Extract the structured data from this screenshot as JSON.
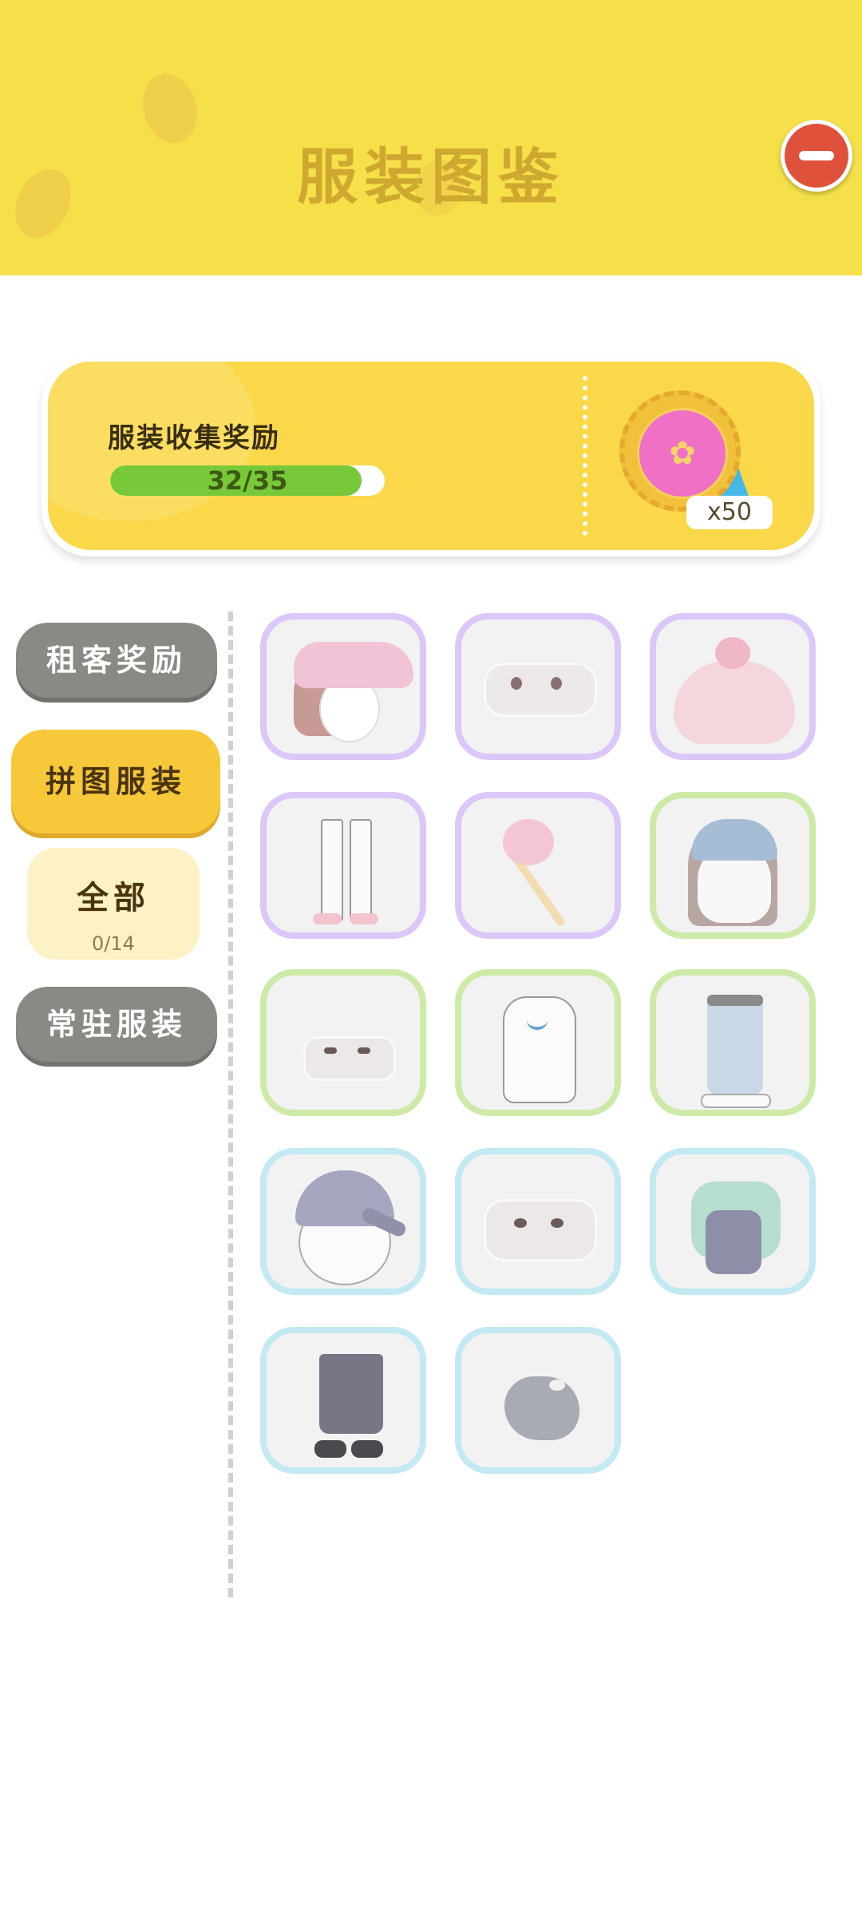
{
  "header": {
    "title": "服装图鉴"
  },
  "reward": {
    "label": "服装收集奖励",
    "progress_text": "32/35",
    "progress_ratio": 0.9143,
    "medal_count": "x50"
  },
  "sidebar": {
    "items": [
      {
        "label": "租客奖励"
      },
      {
        "label": "拼图服装"
      },
      {
        "label": "全部",
        "count": "0/14"
      },
      {
        "label": "常驻服装"
      }
    ]
  },
  "grid": {
    "items": [
      {
        "kind": "hat-hair",
        "frame": "purple"
      },
      {
        "kind": "face",
        "frame": "purple"
      },
      {
        "kind": "dress",
        "frame": "purple"
      },
      {
        "kind": "pants",
        "frame": "purple"
      },
      {
        "kind": "wand",
        "frame": "purple"
      },
      {
        "kind": "hair",
        "frame": "green"
      },
      {
        "kind": "face",
        "frame": "green"
      },
      {
        "kind": "shirt",
        "frame": "green"
      },
      {
        "kind": "pants",
        "frame": "green"
      },
      {
        "kind": "cap",
        "frame": "blue"
      },
      {
        "kind": "face",
        "frame": "blue"
      },
      {
        "kind": "outfit",
        "frame": "blue"
      },
      {
        "kind": "pants",
        "frame": "blue"
      },
      {
        "kind": "bag",
        "frame": "blue"
      }
    ]
  }
}
